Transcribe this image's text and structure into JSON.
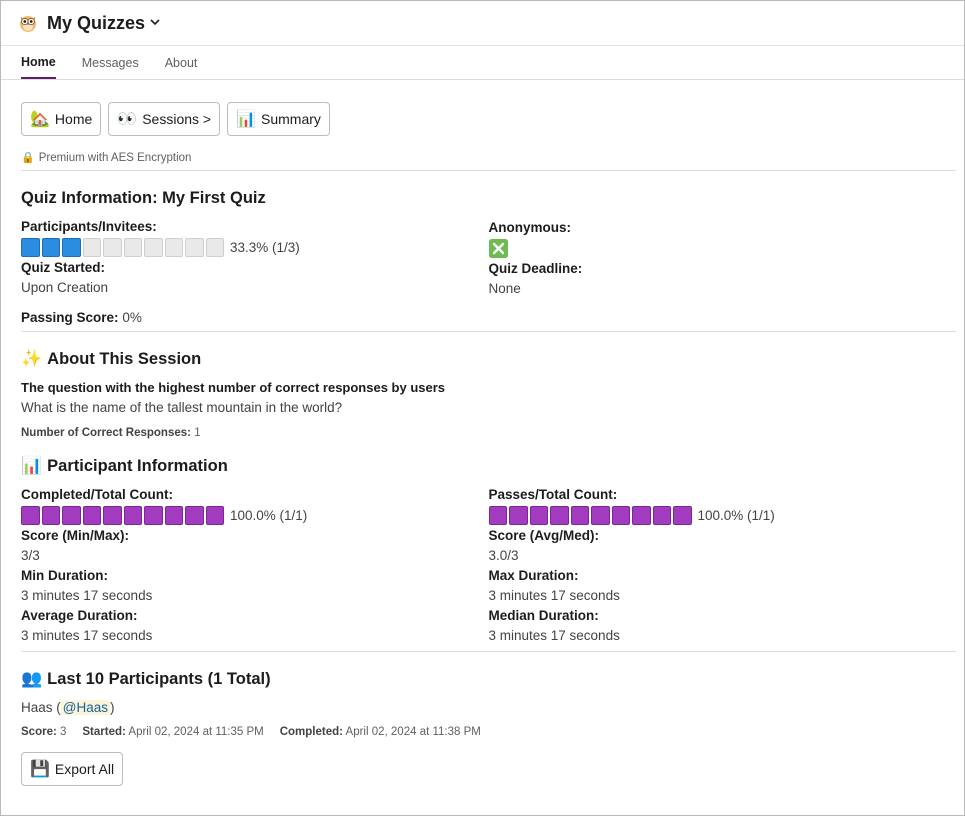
{
  "app": {
    "title": "My Quizzes"
  },
  "tabs": [
    {
      "label": "Home",
      "active": true
    },
    {
      "label": "Messages",
      "active": false
    },
    {
      "label": "About",
      "active": false
    }
  ],
  "buttons": {
    "home": {
      "emoji": "🏡",
      "label": "Home"
    },
    "sessions": {
      "emoji": "👀",
      "label": "Sessions >"
    },
    "summary": {
      "emoji": "📊",
      "label": "Summary"
    }
  },
  "premium": {
    "emoji": "🔒",
    "text": "Premium with AES Encryption"
  },
  "quiz_info": {
    "title": "Quiz Information: My First Quiz",
    "participants_label": "Participants/Invitees:",
    "participants_progress": {
      "filled": 3,
      "total": 10,
      "text": "33.3% (1/3)"
    },
    "anonymous_label": "Anonymous:",
    "anonymous_value": "❎",
    "started_label": "Quiz Started:",
    "started_value": "Upon Creation",
    "deadline_label": "Quiz Deadline:",
    "deadline_value": "None",
    "passing_label": "Passing Score:",
    "passing_value": "0%"
  },
  "about_session": {
    "emoji": "✨",
    "title": "About This Session",
    "question_label": "The question with the highest number of correct responses by users",
    "question_text": "What is the name of the tallest mountain in the world?",
    "correct_label": "Number of Correct Responses:",
    "correct_value": "1"
  },
  "participant_info": {
    "emoji": "📊",
    "title": "Participant Information",
    "completed_label": "Completed/Total Count:",
    "completed_progress": {
      "filled": 10,
      "total": 10,
      "text": "100.0% (1/1)"
    },
    "passes_label": "Passes/Total Count:",
    "passes_progress": {
      "filled": 10,
      "total": 10,
      "text": "100.0% (1/1)"
    },
    "score_minmax_label": "Score (Min/Max):",
    "score_minmax_value": "3/3",
    "score_avgmed_label": "Score (Avg/Med):",
    "score_avgmed_value": "3.0/3",
    "min_duration_label": "Min Duration:",
    "min_duration_value": "3 minutes 17 seconds",
    "max_duration_label": "Max Duration:",
    "max_duration_value": "3 minutes 17 seconds",
    "avg_duration_label": "Average Duration:",
    "avg_duration_value": "3 minutes 17 seconds",
    "median_duration_label": "Median Duration:",
    "median_duration_value": "3 minutes 17 seconds"
  },
  "last_participants": {
    "emoji": "👥",
    "title": "Last 10 Participants (1 Total)",
    "name": "Haas",
    "handle": "@Haas",
    "score_label": "Score:",
    "score_value": "3",
    "started_label": "Started:",
    "started_value": "April 02, 2024 at 11:35 PM",
    "completed_label": "Completed:",
    "completed_value": "April 02, 2024 at 11:38 PM"
  },
  "export": {
    "emoji": "💾",
    "label": "Export All"
  },
  "colors": {
    "accent": "#611f69",
    "progress_blue": "#2a8de0",
    "progress_purple": "#a33bc0",
    "progress_empty": "#e9e9e9",
    "mention_bg": "#fdf3d6",
    "mention_text": "#1264a3"
  }
}
